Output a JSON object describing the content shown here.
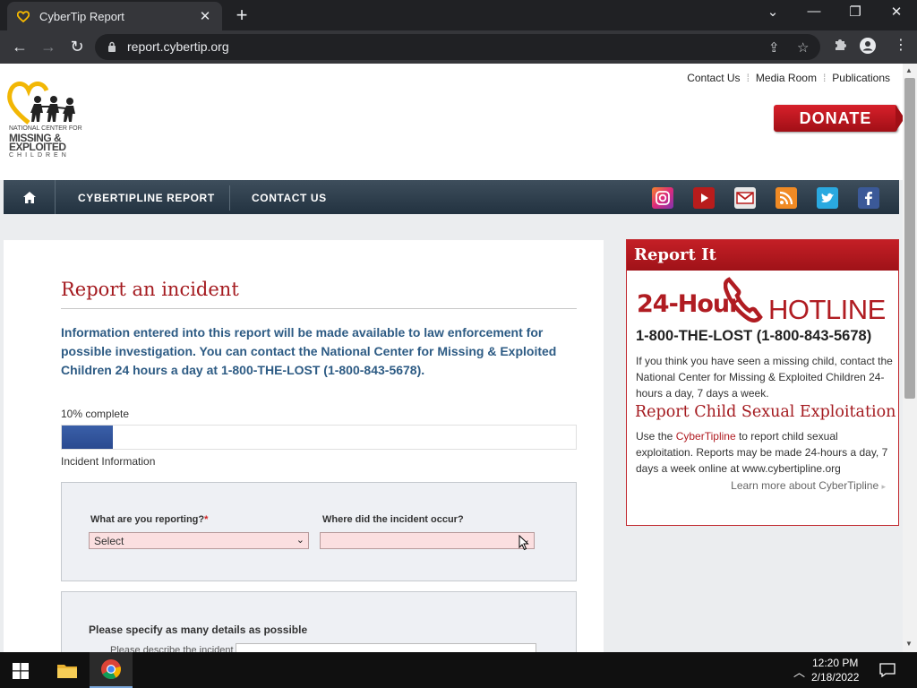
{
  "browser": {
    "tab_title": "CyberTip Report",
    "url": "report.cybertip.org",
    "new_tab": "+",
    "close_tab": "✕"
  },
  "header": {
    "logo_text": [
      "NATIONAL CENTER FOR",
      "MISSING &",
      "EXPLOITED",
      "CHILDREN"
    ],
    "top_links": [
      "Contact Us",
      "Media Room",
      "Publications"
    ],
    "donate": "DONATE"
  },
  "nav": {
    "items": [
      "CYBERTIPLINE REPORT",
      "CONTACT US"
    ],
    "social": [
      "instagram-icon",
      "youtube-icon",
      "email-icon",
      "rss-icon",
      "twitter-icon",
      "facebook-icon"
    ]
  },
  "form": {
    "title": "Report an incident",
    "intro": "Information entered into this report will be made available to law enforcement for possible investigation. You can contact the National Center for Missing & Exploited Children 24 hours a day at 1-800-THE-LOST (1-800-843-5678).",
    "progress_label": "10% complete",
    "progress_percent": 10,
    "step_label": "Incident Information",
    "reporting_label": "What are you reporting?",
    "required_mark": "*",
    "reporting_value": "Select",
    "where_label": "Where did the incident occur?",
    "where_value": "",
    "details_label": "Please specify as many details as possible",
    "describe_label": "Please describe the incident"
  },
  "sidebar": {
    "title": "Report It",
    "hotline_left": "24-Hour",
    "hotline_right": "HOTLINE",
    "phone": "1-800-THE-LOST (1-800-843-5678)",
    "hotline_text": "If you think you have seen a missing child, contact the National Center for Missing & Exploited Children 24-hours a day, 7 days a week.",
    "exploit_title": "Report Child Sexual Exploitation",
    "exploit_pre": "Use the ",
    "exploit_link": "CyberTipline",
    "exploit_post": " to report child sexual exploitation. Reports may be made 24-hours a day, 7 days a week online at www.cybertipline.org",
    "learn_more": "Learn more about CyberTipline"
  },
  "taskbar": {
    "time": "12:20 PM",
    "date": "2/18/2022"
  },
  "colors": {
    "brand_red": "#a41a1f",
    "nav_dark": "#2d3d4b",
    "intro_blue": "#2d5b84",
    "progress_blue": "#3a5fa8"
  }
}
